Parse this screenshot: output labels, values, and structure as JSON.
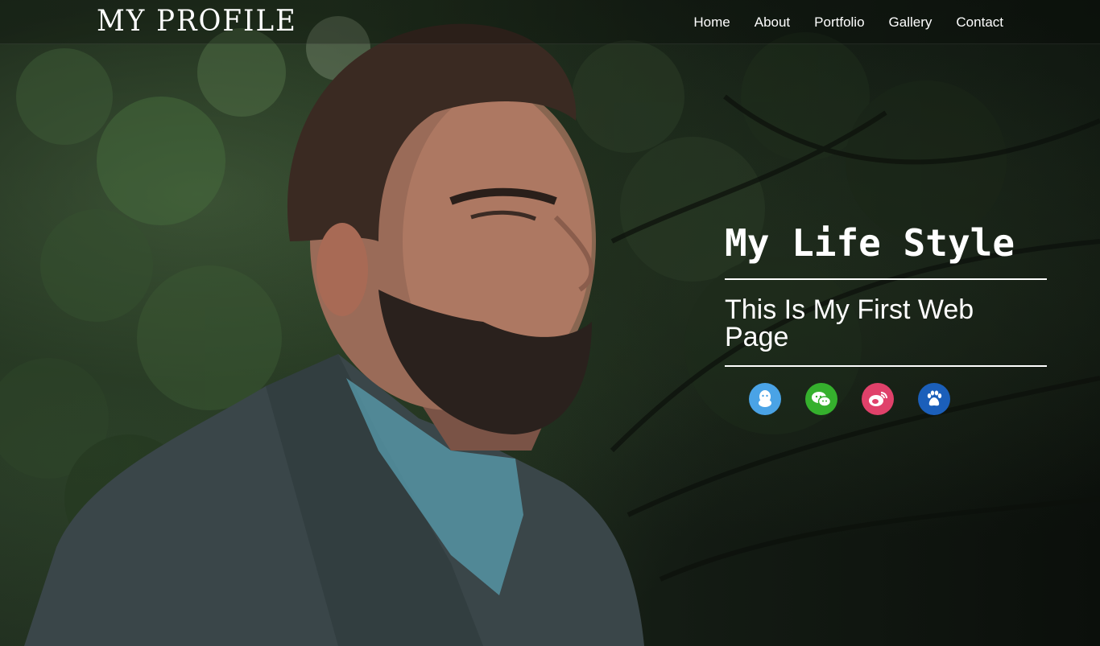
{
  "header": {
    "logo": "MY PROFILE",
    "nav": [
      {
        "label": "Home"
      },
      {
        "label": "About"
      },
      {
        "label": "Portfolio"
      },
      {
        "label": "Gallery"
      },
      {
        "label": "Contact"
      }
    ]
  },
  "hero": {
    "title": "My Life Style",
    "subtitle": "This Is My First Web Page"
  },
  "social": [
    {
      "icon": "qq-icon",
      "color": "#4aa3e6"
    },
    {
      "icon": "wechat-icon",
      "color": "#35b02d"
    },
    {
      "icon": "weibo-icon",
      "color": "#e0416a"
    },
    {
      "icon": "baidu-icon",
      "color": "#1b5fba"
    }
  ],
  "colors": {
    "text": "#ffffff",
    "header_overlay": "rgba(0,0,0,0.25)"
  }
}
